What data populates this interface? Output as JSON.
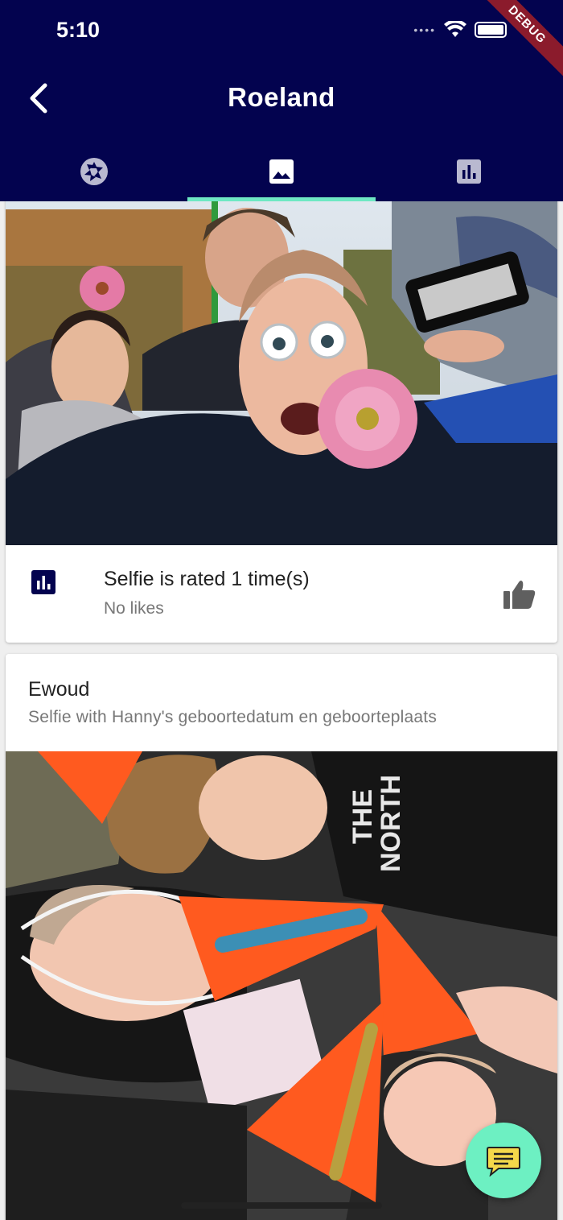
{
  "status_bar": {
    "time": "5:10",
    "signal": "••••"
  },
  "debug_banner": "DEBUG",
  "app_bar": {
    "title": "Roeland"
  },
  "tabs": [
    {
      "name": "camera-shutter-icon",
      "active": false
    },
    {
      "name": "image-icon",
      "active": true
    },
    {
      "name": "bar-chart-icon",
      "active": false
    }
  ],
  "selfie_card": {
    "rating_text": "Selfie is rated 1 time(s)",
    "likes_text": "No likes"
  },
  "second_card": {
    "author": "Ewoud",
    "description": "Selfie with Hanny's geboortedatum en geboorteplaats"
  },
  "colors": {
    "primary": "#03034f",
    "accent": "#6ee8c3",
    "fab": "#6df0c2"
  }
}
